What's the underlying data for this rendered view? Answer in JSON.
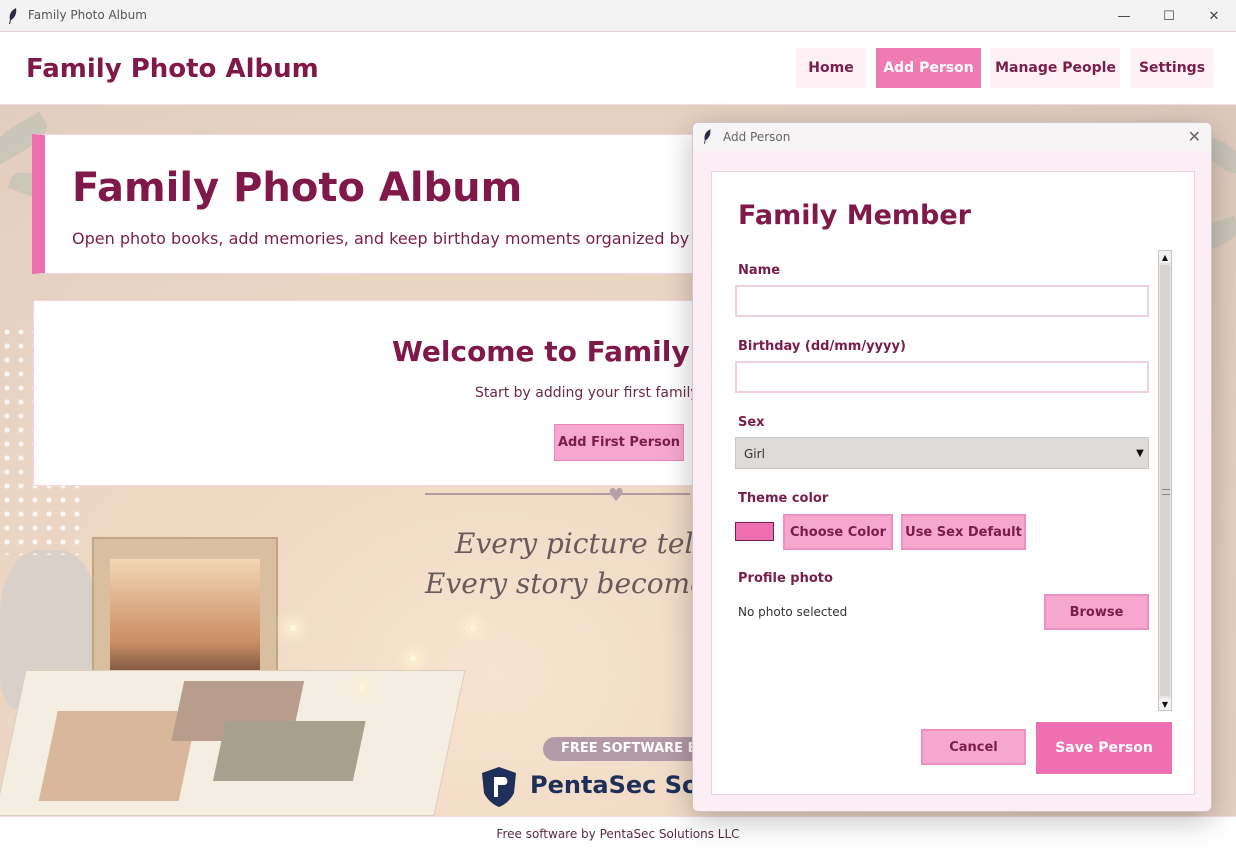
{
  "window": {
    "title": "Family Photo Album",
    "minimize_icon": "minimize-icon",
    "maximize_icon": "maximize-icon",
    "close_icon": "close-icon"
  },
  "header": {
    "brand": "Family Photo Album",
    "nav": [
      {
        "label": "Home",
        "active": false
      },
      {
        "label": "Add Person",
        "active": true
      },
      {
        "label": "Manage People",
        "active": false
      },
      {
        "label": "Settings",
        "active": false
      }
    ]
  },
  "hero": {
    "title": "Family Photo Album",
    "subtitle": "Open photo books, add memories, and keep birthday moments organized by yea"
  },
  "welcome": {
    "title": "Welcome to Family Ph",
    "subtitle": "Start by adding your first family",
    "button_label": "Add First Person"
  },
  "background": {
    "quote_line1": "Every picture tells a",
    "quote_line2": "Every story becomes a",
    "banner": "FREE SOFTWARE B",
    "logo_text": "PentaSec Solut"
  },
  "dialog": {
    "window_title": "Add Person",
    "heading": "Family Member",
    "name_label": "Name",
    "name_value": "",
    "birthday_label": "Birthday (dd/mm/yyyy)",
    "birthday_value": "",
    "sex_label": "Sex",
    "sex_value": "Girl",
    "theme_label": "Theme color",
    "theme_color": "#ef70b0",
    "choose_color_label": "Choose Color",
    "use_default_label": "Use Sex Default",
    "photo_label": "Profile photo",
    "photo_status": "No photo selected",
    "browse_label": "Browse",
    "cancel_label": "Cancel",
    "save_label": "Save Person"
  },
  "footer": {
    "text": "Free software by PentaSec Solutions LLC"
  },
  "colors": {
    "accent": "#ef70b0",
    "brand_text": "#80194a",
    "button_light": "#f6a7cf"
  }
}
